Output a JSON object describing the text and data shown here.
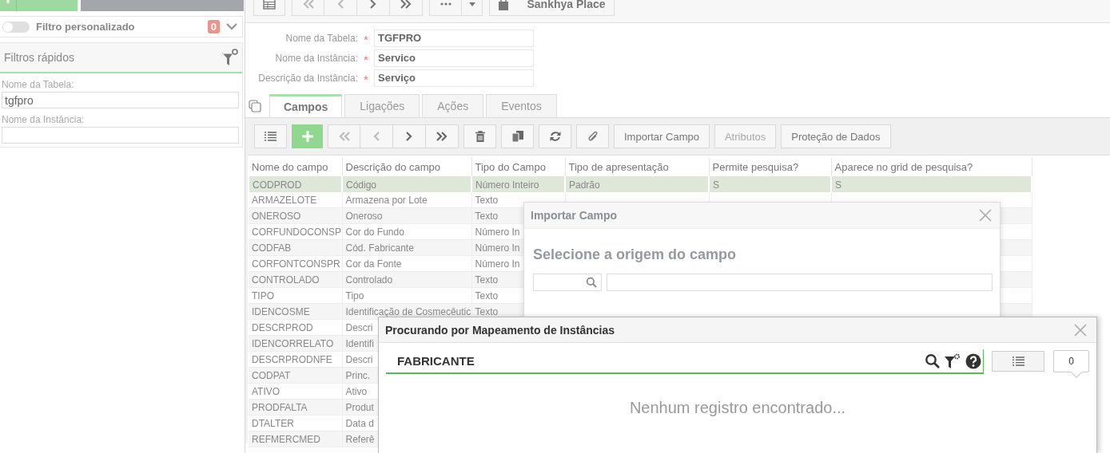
{
  "sidebar": {
    "buttons": [
      {
        "kind": "add"
      },
      {
        "kind": "apply"
      }
    ],
    "custom_filter": {
      "label": "Filtro personalizado",
      "on": false,
      "count": "0"
    },
    "quick_filters": {
      "title": "Filtros rápidos",
      "fields": [
        {
          "label": "Nome da Tabela:",
          "value": "tgfpro"
        },
        {
          "label": "Nome da Instância:"
        }
      ]
    }
  },
  "toolbar": {
    "place_button": "Sankhya Place"
  },
  "form": {
    "fields": [
      {
        "label": "Nome da Tabela:",
        "mark": "*",
        "value": "TGFPRO"
      },
      {
        "label": "Nome da Instância:",
        "mark": "*",
        "value": "Servico"
      },
      {
        "label": "Descrição da Instância:",
        "mark": "*",
        "value": "Serviço"
      }
    ]
  },
  "tabs": [
    {
      "label": "Campos",
      "selected": true
    },
    {
      "label": "Ligações",
      "selected": false
    },
    {
      "label": "Ações",
      "selected": false
    },
    {
      "label": "Eventos",
      "selected": false
    }
  ],
  "grid_toolbar": {
    "buttons": [
      {
        "label": "Importar Campo",
        "disabled": false
      },
      {
        "label": "Atributos",
        "disabled": true
      },
      {
        "label": "Proteção de Dados",
        "disabled": false
      }
    ]
  },
  "table": {
    "columns": [
      "Nome do campo",
      "Descrição do campo",
      "Tipo do Campo",
      "Tipo de apresentação",
      "Permite pesquisa?",
      "Aparece no grid de pesquisa?"
    ],
    "rows": [
      {
        "selected": true,
        "cells": [
          "CODPROD",
          "Código",
          "Número Inteiro",
          "Padrão",
          "S",
          "S"
        ]
      },
      {
        "selected": false,
        "cells": [
          "ARMAZELOTE",
          "Armazena por Lote",
          "Texto"
        ]
      },
      {
        "selected": false,
        "cells": [
          "ONEROSO",
          "Oneroso",
          "Texto"
        ]
      },
      {
        "selected": false,
        "cells": [
          "CORFUNDOCONSP",
          "Cor do Fundo",
          "Número In"
        ]
      },
      {
        "selected": false,
        "cells": [
          "CODFAB",
          "Cód. Fabricante",
          "Número In"
        ]
      },
      {
        "selected": false,
        "cells": [
          "CORFONTCONSPR",
          "Cor da Fonte",
          "Número In"
        ]
      },
      {
        "selected": false,
        "cells": [
          "CONTROLADO",
          "Controlado",
          "Texto"
        ]
      },
      {
        "selected": false,
        "cells": [
          "TIPO",
          "Tipo",
          "Texto"
        ]
      },
      {
        "selected": false,
        "cells": [
          "IDENCOSME",
          "Identificação de Cosmecêutic",
          "Texto"
        ]
      },
      {
        "selected": false,
        "cells": [
          "DESCRPROD",
          "Descri"
        ]
      },
      {
        "selected": false,
        "cells": [
          "IDENCORRELATO",
          "Identifi"
        ]
      },
      {
        "selected": false,
        "cells": [
          "DESCRPRODNFE",
          "Descri"
        ]
      },
      {
        "selected": false,
        "cells": [
          "CODPAT",
          "Princ."
        ]
      },
      {
        "selected": false,
        "cells": [
          "ATIVO",
          "Ativo"
        ]
      },
      {
        "selected": false,
        "cells": [
          "PRODFALTA",
          "Produt"
        ]
      },
      {
        "selected": false,
        "cells": [
          "DTALTER",
          "Data d"
        ]
      },
      {
        "selected": false,
        "cells": [
          "REFMERCMED",
          "Referê"
        ]
      }
    ]
  },
  "import_dialog": {
    "title": "Importar Campo",
    "heading": "Selecione a origem do campo"
  },
  "search_dialog": {
    "title": "Procurando por Mapeamento de Instâncias",
    "query": "FABRICANTE",
    "count": "0",
    "empty_message": "Nenhum registro encontrado..."
  }
}
